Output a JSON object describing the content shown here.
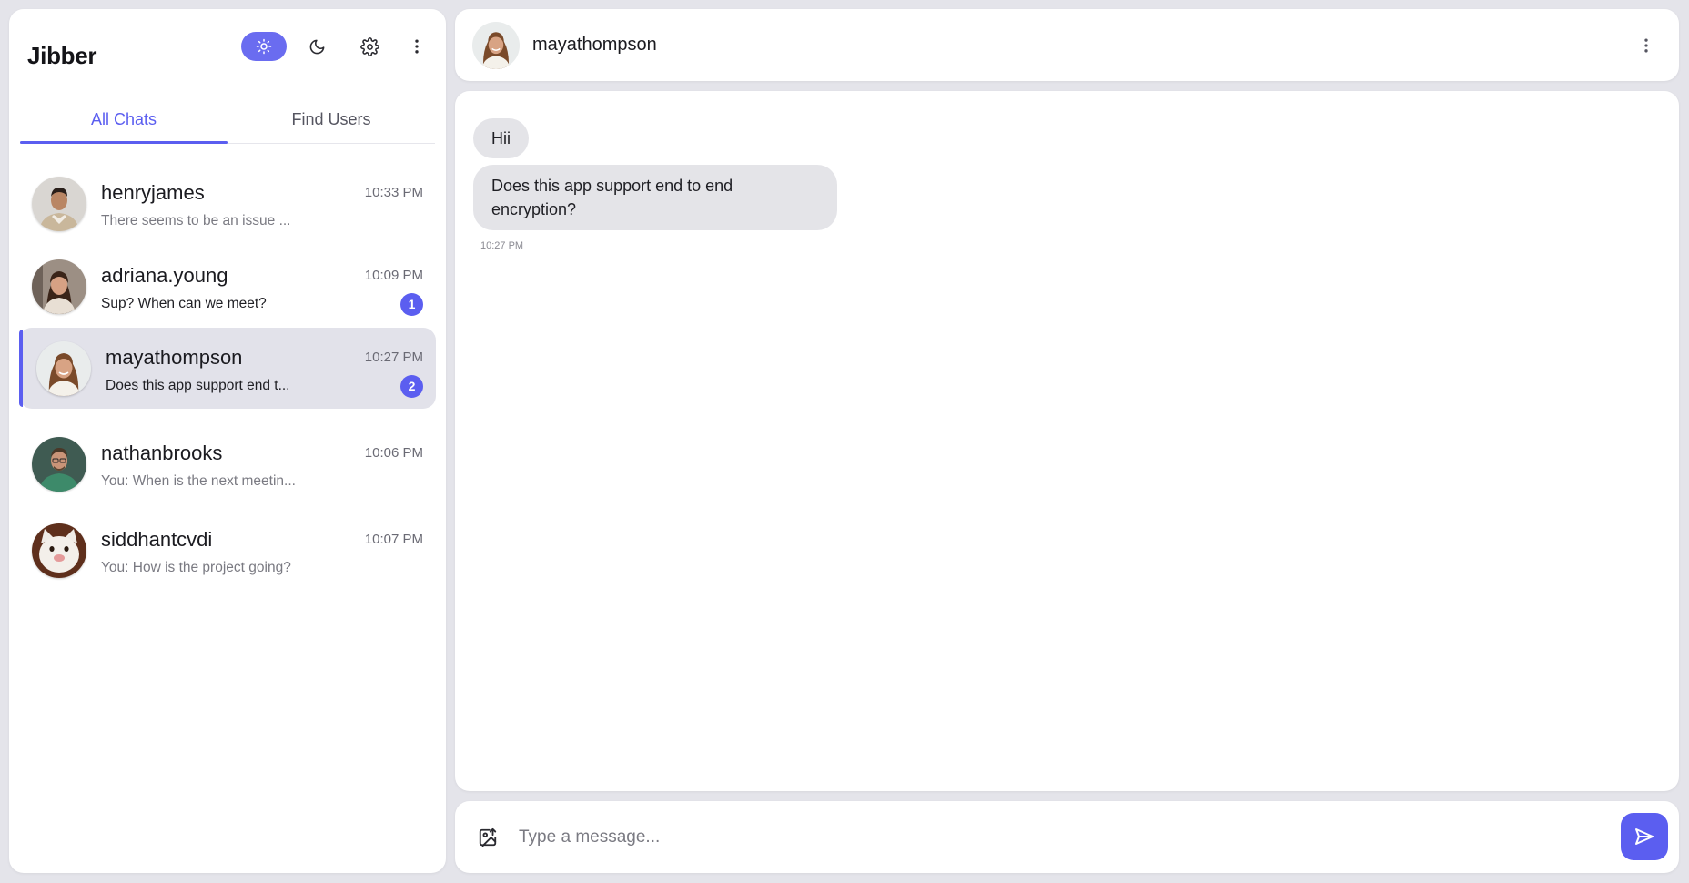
{
  "app": {
    "title": "Jibber"
  },
  "tabs": [
    {
      "label": "All Chats",
      "active": true
    },
    {
      "label": "Find Users",
      "active": false
    }
  ],
  "header_icons": [
    "sun-icon",
    "moon-icon",
    "gear-icon",
    "more-vertical-icon"
  ],
  "chats": [
    {
      "name": "henryjames",
      "time": "10:33 PM",
      "preview": "There seems to be an issue ...",
      "unread": ""
    },
    {
      "name": "adriana.young",
      "time": "10:09 PM",
      "preview": "Sup? When can we meet?",
      "unread": "1"
    },
    {
      "name": "mayathompson",
      "time": "10:27 PM",
      "preview": "Does this app support end t...",
      "unread": "2"
    },
    {
      "name": "nathanbrooks",
      "time": "10:06 PM",
      "preview": "You: When is the next meetin...",
      "unread": ""
    },
    {
      "name": "siddhantcvdi",
      "time": "10:07 PM",
      "preview": "You: How is the project going?",
      "unread": ""
    }
  ],
  "active_chat": {
    "name": "mayathompson",
    "messages": [
      {
        "text": "Hii"
      },
      {
        "text": "Does this app support end to end encryption?"
      }
    ],
    "last_time": "10:27 PM"
  },
  "composer": {
    "placeholder": "Type a message..."
  },
  "colors": {
    "accent": "#5b5ef0",
    "bubble": "#e4e4e8",
    "background": "#e4e4ea",
    "active_row": "#e2e2ea"
  }
}
